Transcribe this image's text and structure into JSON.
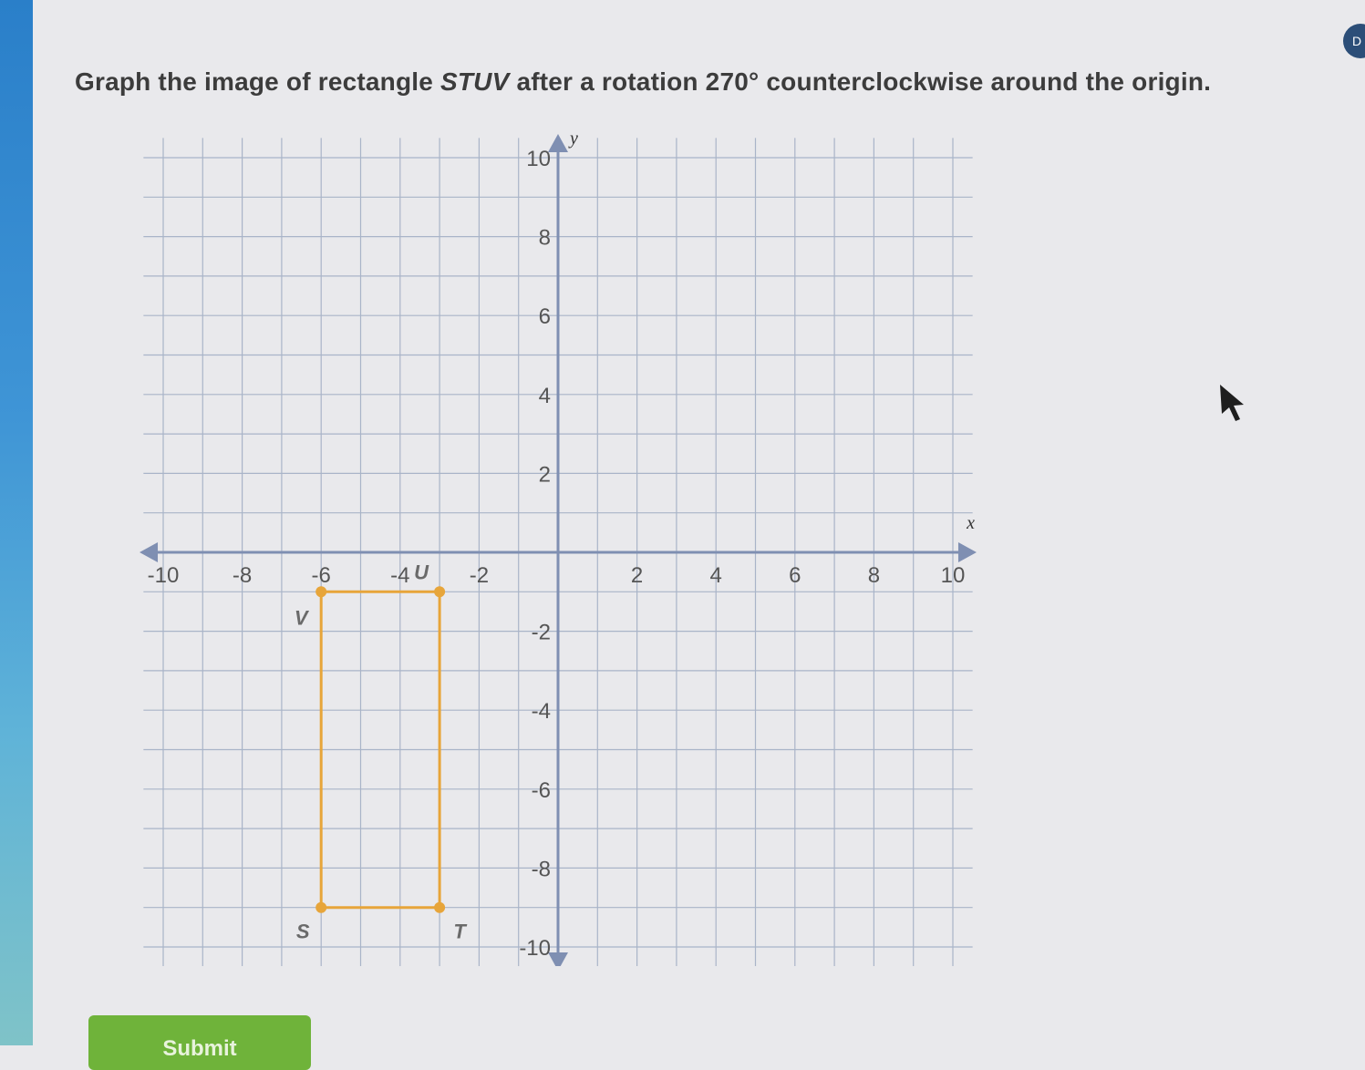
{
  "question": {
    "prefix": "Graph the image of rectangle ",
    "shape_name": "STUV",
    "middle": " after a rotation ",
    "angle": "270°",
    "suffix": " counterclockwise around the origin."
  },
  "corner_badge": {
    "label": "D",
    "icon": "nav-badge-icon"
  },
  "submit": {
    "label": "Submit"
  },
  "colors": {
    "grid_line": "#a9b4c8",
    "axis": "#7f8fb2",
    "rectangle": "#e7a53a",
    "submit_bg": "#6fb33a",
    "label_text": "#555555"
  },
  "chart_data": {
    "type": "coordinate-plane",
    "xlim": [
      -10,
      10
    ],
    "ylim": [
      -10,
      10
    ],
    "grid": true,
    "grid_step": 1,
    "x_axis_label": "x",
    "y_axis_label": "y",
    "x_ticks": [
      -10,
      -8,
      -6,
      -4,
      -2,
      2,
      4,
      6,
      8,
      10
    ],
    "x_tick_labels": [
      "-10",
      "-8",
      "-6",
      "-4",
      "-2",
      "2",
      "4",
      "6",
      "8",
      "10"
    ],
    "y_ticks": [
      10,
      8,
      6,
      4,
      2,
      -2,
      -4,
      -6,
      -8,
      -10
    ],
    "y_tick_labels": [
      "10",
      "8",
      "6",
      "4",
      "2",
      "-2",
      "-4",
      "-6",
      "-8",
      "-10"
    ],
    "shape": {
      "name": "STUV",
      "vertices": [
        {
          "label": "S",
          "x": -6,
          "y": -9
        },
        {
          "label": "T",
          "x": -3,
          "y": -9
        },
        {
          "label": "U",
          "x": -3,
          "y": -1
        },
        {
          "label": "V",
          "x": -6,
          "y": -1
        }
      ]
    }
  }
}
